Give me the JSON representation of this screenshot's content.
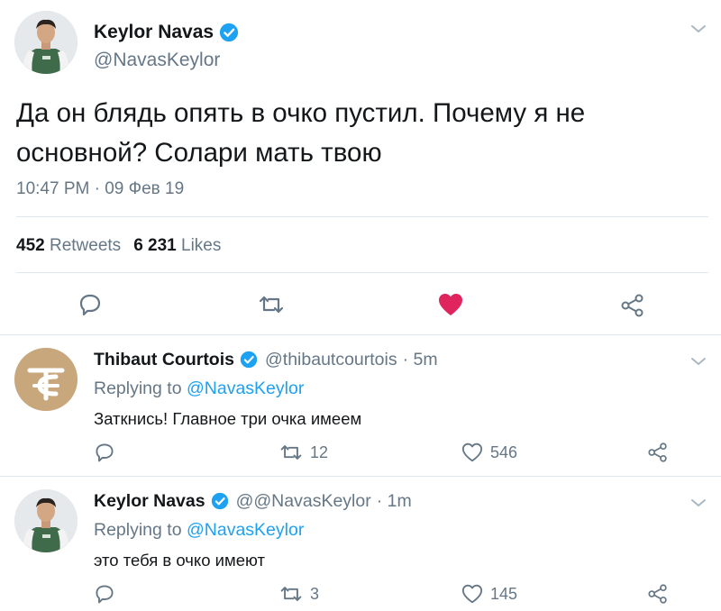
{
  "main_tweet": {
    "name": "Keylor Navas",
    "handle": "@NavasKeylor",
    "text": "Да он блядь опять в очко пустил. Почему я не основной? Солари мать твою",
    "timestamp": "10:47 PM · 09 Фев 19",
    "retweets_count": "452",
    "retweets_label": "Retweets",
    "likes_count": "6 231",
    "likes_label": "Likes",
    "liked": true,
    "accent": "#1da1f2",
    "like_color": "#e0245e"
  },
  "replies": [
    {
      "name": "Thibaut Courtois",
      "handle": "@thibautcourtois",
      "time": "· 5m",
      "replying_prefix": "Replying to",
      "replying_to": "@NavasKeylor",
      "text": "Заткнись! Главное три очка имеем",
      "retweets": "12",
      "likes": "546",
      "avatar_color": "#c9a77c"
    },
    {
      "name": "Keylor Navas",
      "handle": "@@NavasKeylor",
      "time": "· 1m",
      "replying_prefix": "Replying to",
      "replying_to": "@NavasKeylor",
      "text": "это тебя в очко имеют",
      "retweets": "3",
      "likes": "145"
    }
  ]
}
